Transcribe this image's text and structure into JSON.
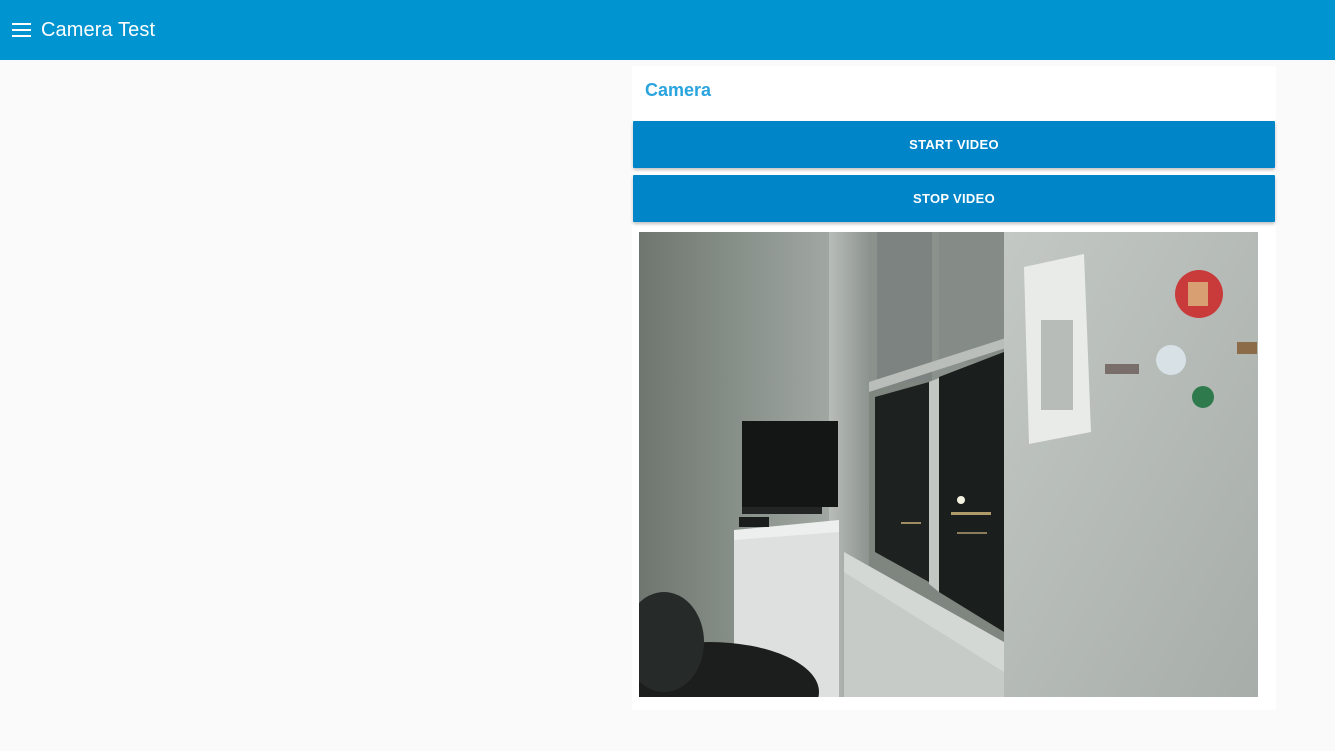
{
  "app_bar": {
    "title": "Camera Test",
    "menu_icon": "hamburger-menu-icon",
    "color": "#0094d0"
  },
  "camera_card": {
    "title": "Camera",
    "title_color": "#2aa4df",
    "start_button_label": "START VIDEO",
    "stop_button_label": "STOP VIDEO",
    "button_color": "#0085c9",
    "video_feed": "camera-feed"
  }
}
